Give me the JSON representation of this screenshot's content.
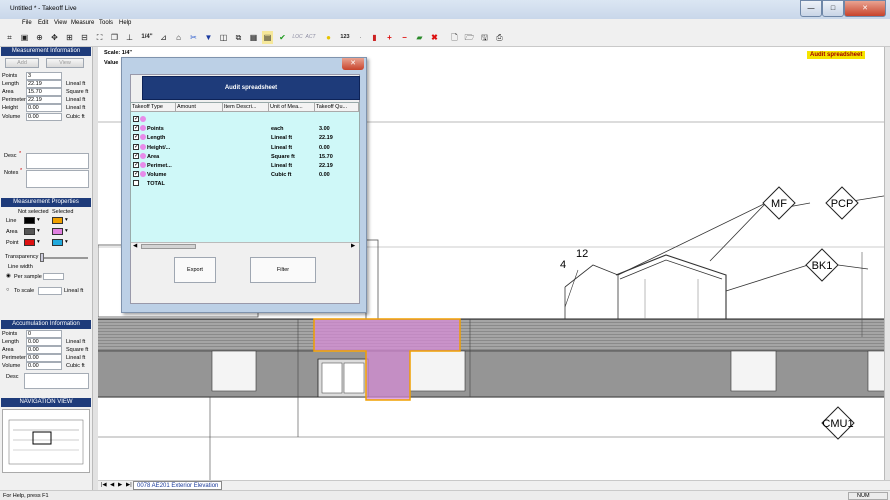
{
  "window": {
    "title": "Untitled * - Takeoff Live",
    "minimize": "—",
    "maximize": "□",
    "close": "✕"
  },
  "menu": [
    "File",
    "Edit",
    "View",
    "Measure",
    "Tools",
    "Help"
  ],
  "toolbar": {
    "scale_btn": "1/4\"",
    "count_btn": "123",
    "loc": "LOC",
    "act": "ACT"
  },
  "measurement_info": {
    "title": "Measurement Information",
    "add": "Add",
    "view": "View",
    "rows": [
      {
        "label": "Points",
        "value": "3",
        "unit": ""
      },
      {
        "label": "Length",
        "value": "22.19",
        "unit": "Lineal ft"
      },
      {
        "label": "Area",
        "value": "15.70",
        "unit": "Square ft"
      },
      {
        "label": "Perimeter",
        "value": "22.19",
        "unit": "Lineal ft"
      },
      {
        "label": "Height",
        "value": "0.00",
        "unit": "Lineal ft"
      },
      {
        "label": "Volume",
        "value": "0.00",
        "unit": "Cubic ft"
      }
    ],
    "desc_label": "Desc",
    "notes_label": "Notes"
  },
  "measurement_props": {
    "title": "Measurement Properties",
    "not_selected": "Not selected",
    "selected": "Selected",
    "line_label": "Line",
    "area_label": "Area",
    "point_label": "Point",
    "transparency_label": "Transparency",
    "line_width_label": "Line width",
    "per_sample": "Per sample",
    "to_scale": "To scale",
    "to_scale_unit": "Lineal ft",
    "colors": {
      "line_ns": "#000000",
      "line_s": "#f0a000",
      "area_ns": "#555555",
      "area_s": "#e080e0",
      "point_ns": "#dd1111",
      "point_s": "#22aadd"
    }
  },
  "accumulation": {
    "title": "Accumulation Information",
    "rows": [
      {
        "label": "Points",
        "value": "0",
        "unit": ""
      },
      {
        "label": "Length",
        "value": "0.00",
        "unit": "Lineal ft"
      },
      {
        "label": "Area",
        "value": "0.00",
        "unit": "Square ft"
      },
      {
        "label": "Perimeter",
        "value": "0.00",
        "unit": "Lineal ft"
      },
      {
        "label": "Volume",
        "value": "0.00",
        "unit": "Cubic ft"
      }
    ],
    "desc_label": "Desc"
  },
  "nav_title": "NAVIGATION VIEW",
  "canvas": {
    "scale_text": "Scale: 1/4\"",
    "value_text": "Value",
    "audit_badge": "Audit spreadsheet",
    "tags": {
      "mf": "MF",
      "pcp": "PCP",
      "bk1": "BK1",
      "cmu1": "CMU1",
      "n12": "12",
      "n4": "4"
    }
  },
  "dialog": {
    "header": "Audit spreadsheet",
    "columns": [
      "Takeoff Type",
      "Amount",
      "Item Descri...",
      "Unit of Mea...",
      "Takeoff Qu..."
    ],
    "rows": [
      {
        "type": "",
        "unit": "",
        "qty": "",
        "dot": true,
        "checked": true
      },
      {
        "type": "Points",
        "unit": "each",
        "qty": "3.00",
        "dot": true,
        "checked": true
      },
      {
        "type": "Length",
        "unit": "Lineal ft",
        "qty": "22.19",
        "dot": true,
        "checked": true
      },
      {
        "type": "Height/...",
        "unit": "Lineal ft",
        "qty": "0.00",
        "dot": true,
        "checked": true
      },
      {
        "type": "Area",
        "unit": "Square ft",
        "qty": "15.70",
        "dot": true,
        "checked": true
      },
      {
        "type": "Perimet...",
        "unit": "Lineal ft",
        "qty": "22.19",
        "dot": true,
        "checked": true
      },
      {
        "type": "Volume",
        "unit": "Cubic ft",
        "qty": "0.00",
        "dot": true,
        "checked": true
      },
      {
        "type": "TOTAL",
        "unit": "",
        "qty": "",
        "dot": false,
        "checked": false
      }
    ],
    "export": "Export",
    "filter": "Filter",
    "close": "✕"
  },
  "sheet_tab": "0078 AE201 Exterior Elevation",
  "status": {
    "left": "For Help, press F1",
    "right": "NUM"
  }
}
